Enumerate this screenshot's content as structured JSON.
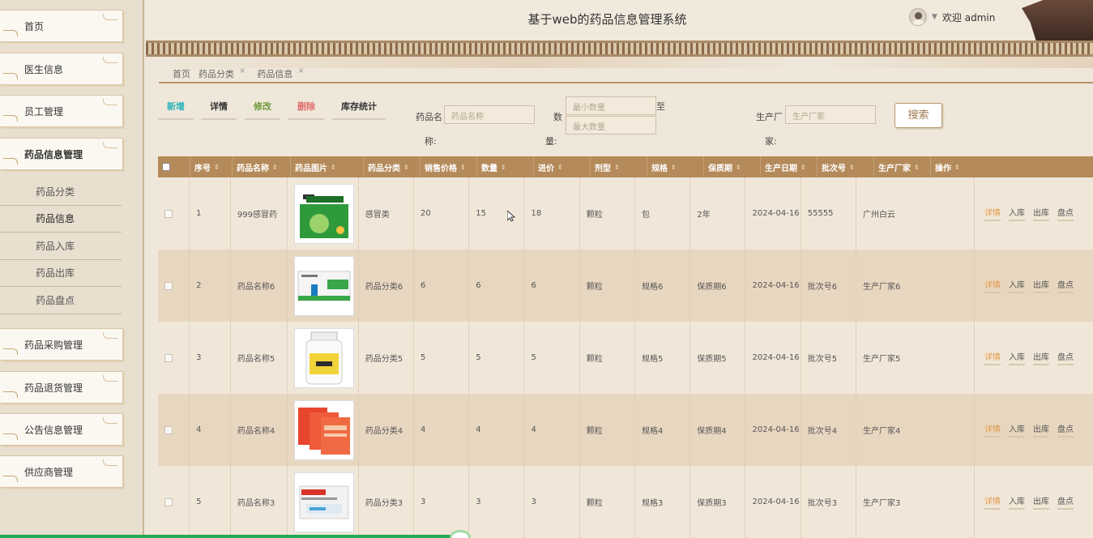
{
  "app": {
    "title": "基于web的药品信息管理系统",
    "welcome": "欢迎 admin"
  },
  "sidebar": {
    "items": [
      {
        "label": "首页"
      },
      {
        "label": "医生信息"
      },
      {
        "label": "员工管理"
      },
      {
        "label": "药品信息管理"
      },
      {
        "label": "药品采购管理"
      },
      {
        "label": "药品退货管理"
      },
      {
        "label": "公告信息管理"
      },
      {
        "label": "供应商管理"
      }
    ],
    "sub_items": [
      {
        "label": "药品分类"
      },
      {
        "label": "药品信息"
      },
      {
        "label": "药品入库"
      },
      {
        "label": "药品出库"
      },
      {
        "label": "药品盘点"
      }
    ]
  },
  "breadcrumb": {
    "home": "首页",
    "tab1": "药品分类",
    "tab2": "药品信息",
    "close": "×"
  },
  "toolbar": {
    "add": "新增",
    "detail": "详情",
    "edit": "修改",
    "delete": "删除",
    "stock": "库存统计",
    "colors": {
      "add": "#2bb3b8",
      "detail": "#333333",
      "edit": "#6f9a3a",
      "delete": "#e26b6b",
      "stock": "#333333"
    }
  },
  "filters": {
    "name_label_a": "药品名",
    "name_label_b": "称:",
    "name_placeholder": "药品名称",
    "qty_label_a": "数",
    "qty_label_b": "量:",
    "qty_min_placeholder": "最小数量",
    "qty_max_placeholder": "最大数量",
    "to": "至",
    "maker_label_a": "生产厂",
    "maker_label_b": "家:",
    "maker_placeholder": "生产厂家",
    "search": "搜索"
  },
  "table": {
    "headers": [
      "序号",
      "药品名称",
      "药品图片",
      "药品分类",
      "销售价格",
      "数量",
      "进价",
      "剂型",
      "规格",
      "保质期",
      "生产日期",
      "批次号",
      "生产厂家",
      "操作"
    ],
    "sort_icon": "⇕",
    "ops": [
      "详情",
      "入库",
      "出库",
      "盘点"
    ],
    "rows": [
      {
        "no": "1",
        "name": "999感冒药",
        "category": "感冒类",
        "price": "20",
        "qty": "15",
        "cost": "18",
        "form": "颗粒",
        "spec": "包",
        "shelf": "2年",
        "date": "2024-04-16",
        "batch": "55555",
        "maker": "广州白云",
        "image": "box-green"
      },
      {
        "no": "2",
        "name": "药品名称6",
        "category": "药品分类6",
        "price": "6",
        "qty": "6",
        "cost": "6",
        "form": "颗粒",
        "spec": "规格6",
        "shelf": "保质期6",
        "date": "2024-04-16",
        "batch": "批次号6",
        "maker": "生产厂家6",
        "image": "box-white-green"
      },
      {
        "no": "3",
        "name": "药品名称5",
        "category": "药品分类5",
        "price": "5",
        "qty": "5",
        "cost": "5",
        "form": "颗粒",
        "spec": "规格5",
        "shelf": "保质期5",
        "date": "2024-04-16",
        "batch": "批次号5",
        "maker": "生产厂家5",
        "image": "bottle-white"
      },
      {
        "no": "4",
        "name": "药品名称4",
        "category": "药品分类4",
        "price": "4",
        "qty": "4",
        "cost": "4",
        "form": "颗粒",
        "spec": "规格4",
        "shelf": "保质期4",
        "date": "2024-04-16",
        "batch": "批次号4",
        "maker": "生产厂家4",
        "image": "packs-red"
      },
      {
        "no": "5",
        "name": "药品名称3",
        "category": "药品分类3",
        "price": "3",
        "qty": "3",
        "cost": "3",
        "form": "颗粒",
        "spec": "规格3",
        "shelf": "保质期3",
        "date": "2024-04-16",
        "batch": "批次号3",
        "maker": "生产厂家3",
        "image": "box-white-red"
      }
    ]
  }
}
